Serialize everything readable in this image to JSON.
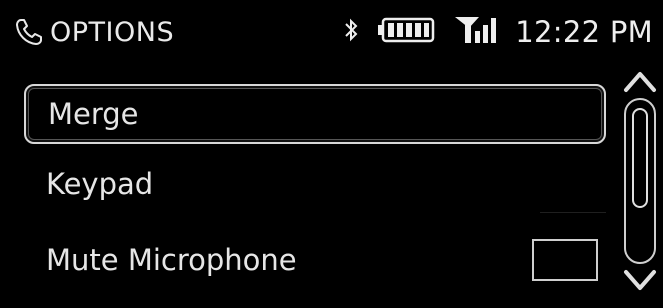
{
  "header": {
    "title": "OPTIONS",
    "title_icon": "phone-icon",
    "status": {
      "bluetooth_icon": "bluetooth-icon",
      "battery_icon": "battery-icon",
      "signal_icon": "signal-icon",
      "time": "12:22 PM"
    }
  },
  "menu": {
    "items": [
      {
        "label": "Merge",
        "selected": true
      },
      {
        "label": "Keypad",
        "selected": false
      },
      {
        "label": "Mute Microphone",
        "selected": false,
        "checkbox": false
      }
    ]
  },
  "scrollbar": {
    "up_icon": "chevron-up-icon",
    "down_icon": "chevron-down-icon"
  },
  "colors": {
    "background": "#000000",
    "text": "#e6e6e6",
    "border": "#d8d8d8"
  }
}
